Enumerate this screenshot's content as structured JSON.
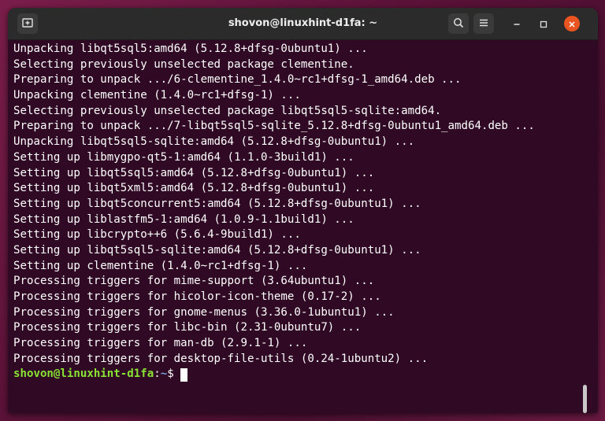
{
  "window": {
    "title": "shovon@linuxhint-d1fa: ~"
  },
  "titlebar": {
    "icons": [
      "new-tab-icon",
      "search-icon",
      "hamburger-menu-icon",
      "minimize-icon",
      "maximize-icon",
      "close-icon"
    ]
  },
  "terminal": {
    "lines": [
      "Unpacking libqt5sql5:amd64 (5.12.8+dfsg-0ubuntu1) ...",
      "Selecting previously unselected package clementine.",
      "Preparing to unpack .../6-clementine_1.4.0~rc1+dfsg-1_amd64.deb ...",
      "Unpacking clementine (1.4.0~rc1+dfsg-1) ...",
      "Selecting previously unselected package libqt5sql5-sqlite:amd64.",
      "Preparing to unpack .../7-libqt5sql5-sqlite_5.12.8+dfsg-0ubuntu1_amd64.deb ...",
      "Unpacking libqt5sql5-sqlite:amd64 (5.12.8+dfsg-0ubuntu1) ...",
      "Setting up libmygpo-qt5-1:amd64 (1.1.0-3build1) ...",
      "Setting up libqt5sql5:amd64 (5.12.8+dfsg-0ubuntu1) ...",
      "Setting up libqt5xml5:amd64 (5.12.8+dfsg-0ubuntu1) ...",
      "Setting up libqt5concurrent5:amd64 (5.12.8+dfsg-0ubuntu1) ...",
      "Setting up liblastfm5-1:amd64 (1.0.9-1.1build1) ...",
      "Setting up libcrypto++6 (5.6.4-9build1) ...",
      "Setting up libqt5sql5-sqlite:amd64 (5.12.8+dfsg-0ubuntu1) ...",
      "Setting up clementine (1.4.0~rc1+dfsg-1) ...",
      "Processing triggers for mime-support (3.64ubuntu1) ...",
      "Processing triggers for hicolor-icon-theme (0.17-2) ...",
      "Processing triggers for gnome-menus (3.36.0-1ubuntu1) ...",
      "Processing triggers for libc-bin (2.31-0ubuntu7) ...",
      "Processing triggers for man-db (2.9.1-1) ...",
      "Processing triggers for desktop-file-utils (0.24-1ubuntu2) ..."
    ],
    "prompt": {
      "user_host": "shovon@linuxhint-d1fa",
      "colon": ":",
      "path": "~",
      "symbol": "$"
    }
  },
  "colors": {
    "terminal_bg": "#300a24",
    "titlebar_bg": "#2b2b2b",
    "prompt_user": "#8ae234",
    "prompt_path": "#729fcf",
    "close_button": "#e95420"
  }
}
